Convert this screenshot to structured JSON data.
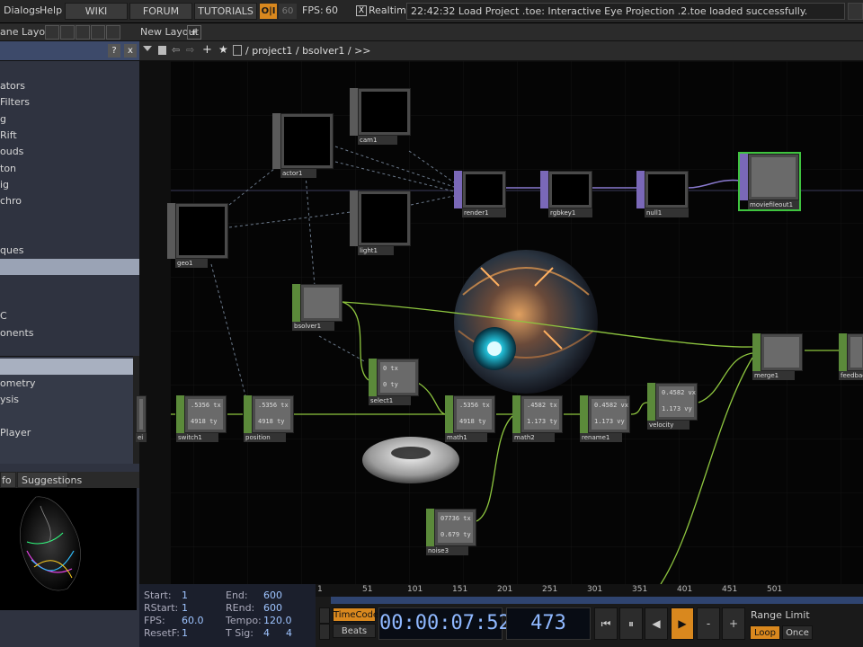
{
  "menu": {
    "dialogs": "Dialogs",
    "help": "Help"
  },
  "toolbar": {
    "wiki": "WIKI",
    "forum": "FORUM",
    "tutorials": "TUTORIALS",
    "oi": "O|I",
    "sixty": "60",
    "fps_label": "FPS:",
    "fps_value": "60",
    "realtime_check": "X",
    "realtime": "Realtime"
  },
  "message": "22:42:32 Load Project .toe: Interactive Eye Projection .2.toe loaded successfully.",
  "pane": {
    "pane_layout": "ane Layout",
    "new_layout": "New Layout",
    "plus": "+"
  },
  "palette": {
    "help": "?",
    "close": "x",
    "items": [
      "ators",
      "Filters",
      "g",
      "Rift",
      "ouds",
      "ton",
      "ig",
      "chro",
      "",
      "",
      "ques",
      "",
      "",
      "",
      "C",
      "onents"
    ],
    "selected_index": 11
  },
  "sublist": {
    "items": [
      "",
      "ometry",
      "ysis",
      "",
      "Player"
    ],
    "selected_index": 0
  },
  "infotabs": {
    "info": "fo",
    "suggestions": "Suggestions"
  },
  "path": {
    "text": "/ project1 / bsolver1 / >>"
  },
  "nodes": {
    "cam1": "cam1",
    "actor1": "actor1",
    "light1": "light1",
    "geo1": "geo1",
    "render1": "render1",
    "rgbkey1": "rgbkey1",
    "null1": "null1",
    "moviefileout1": "moviefileout1",
    "bsolver1": "bsolver1",
    "select1": "select1",
    "switch1": "switch1",
    "position": "position",
    "math1": "math1",
    "math2": "math2",
    "rename1": "rename1",
    "velocity": "velocity",
    "merge1": "merge1",
    "feedback": "feedbac",
    "noise3": "noise3",
    "edge": "ei"
  },
  "node_values": {
    "select1": "0 tx\n\n0 ty",
    "switch1": ".5356 tx\n\n4918 ty",
    "position": ".5356 tx\n\n4918 ty",
    "math1": ".5356 tx\n\n4918 ty",
    "math2": ".4582 tx\n\n1.173 ty",
    "rename1": "0.4582 vx\n\n1.173 vy",
    "velocity": "0.4582 vx\n\n1.173 vy",
    "noise3": "07736 tx\n\n0.679 ty"
  },
  "time": {
    "start_label": "Start:",
    "start": "1",
    "end_label": "End:",
    "end": "600",
    "rstart_label": "RStart:",
    "rstart": "1",
    "rend_label": "REnd:",
    "rend": "600",
    "fps_label": "FPS:",
    "fps": "60.0",
    "tempo_label": "Tempo:",
    "tempo": "120.0",
    "resetf_label": "ResetF:",
    "resetf": "1",
    "tsig_label": "T Sig:",
    "tsig1": "4",
    "tsig2": "4"
  },
  "ruler": [
    "1",
    "51",
    "101",
    "151",
    "201",
    "251",
    "301",
    "351",
    "401",
    "451",
    "501"
  ],
  "transport": {
    "timecode_btn": "TimeCode",
    "beats_btn": "Beats",
    "timecode": "00:00:07:52",
    "frame": "473",
    "range_limit": "Range Limit",
    "loop": "Loop",
    "once": "Once",
    "minus": "-",
    "plus": "+"
  },
  "colors": {
    "accent": "#d9881e",
    "wire_green": "#8ec63f",
    "wire_purple": "#8a7ad0",
    "panel": "#2f3340"
  }
}
